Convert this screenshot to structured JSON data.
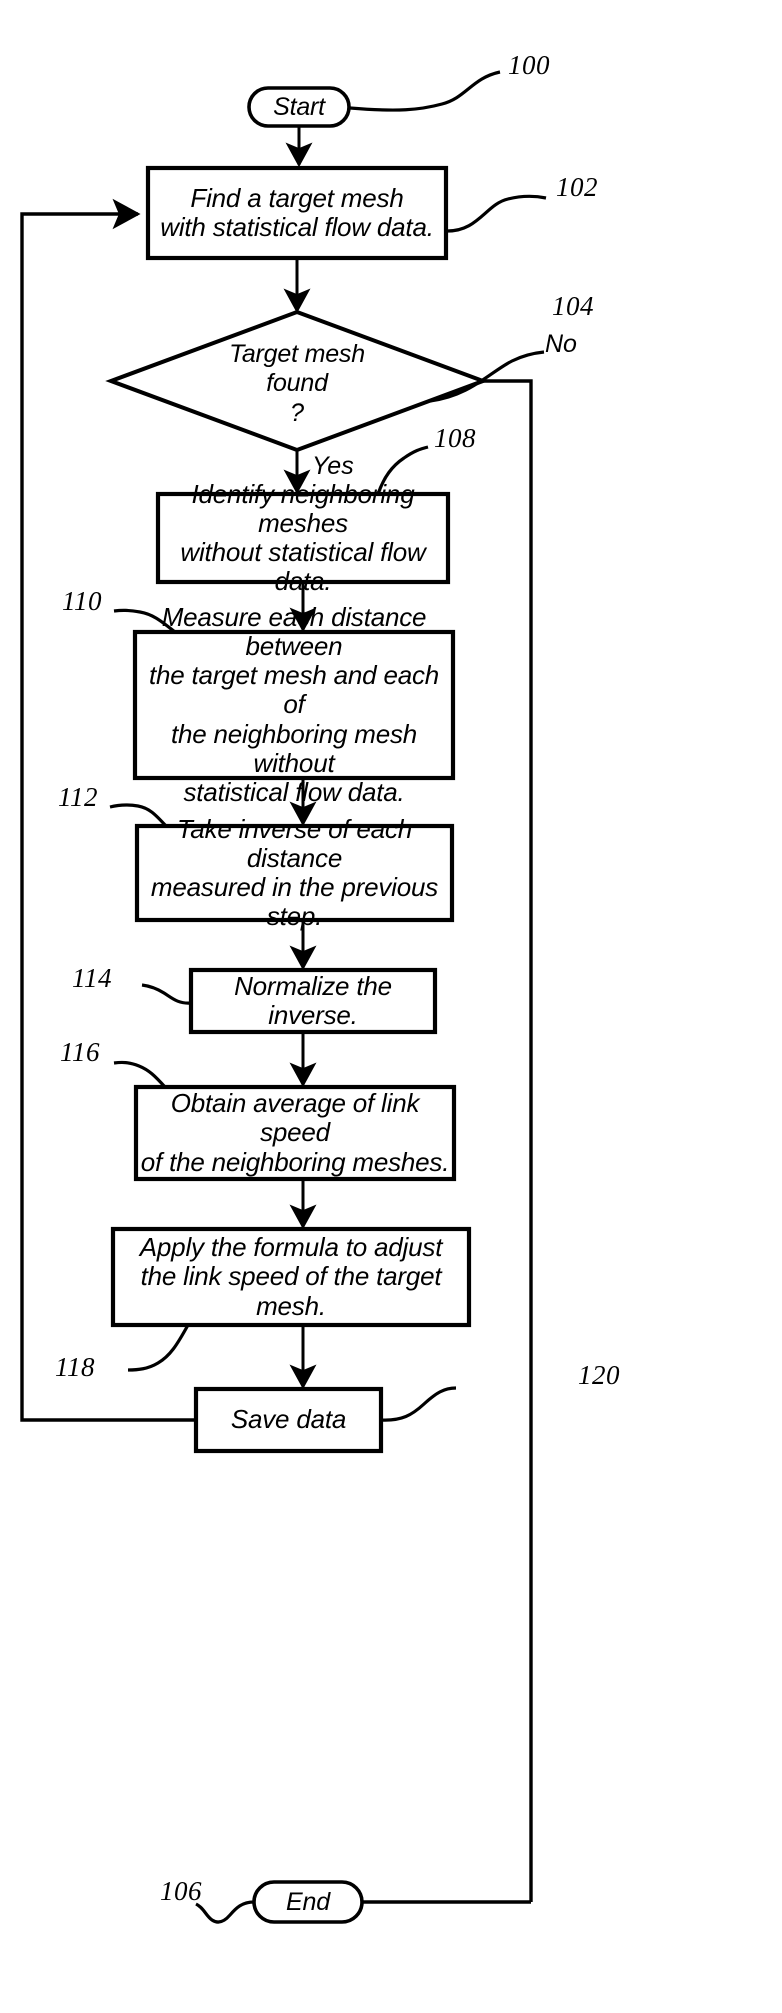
{
  "figure": {
    "type": "patent-flowchart",
    "title": "",
    "stroke_color": "#000000",
    "background_color": "#ffffff"
  },
  "nodes": {
    "start": {
      "ref": "100",
      "label": "Start",
      "shape": "terminator"
    },
    "find_target": {
      "ref": "102",
      "label": "Find a target mesh\nwith statistical flow data.",
      "shape": "process"
    },
    "decision": {
      "ref": "104",
      "label": "Target mesh\nfound\n?",
      "shape": "decision"
    },
    "identify": {
      "ref": "108",
      "label": "Identify neighboring meshes\nwithout statistical flow data.",
      "shape": "process"
    },
    "measure": {
      "ref": "110",
      "label": "Measure each distance between\nthe target mesh and each of\nthe neighboring mesh without\nstatistical flow data.",
      "shape": "process"
    },
    "inverse": {
      "ref": "112",
      "label": "Take inverse of each distance\nmeasured in the previous step.",
      "shape": "process"
    },
    "normalize": {
      "ref": "114",
      "label": "Normalize the inverse.",
      "shape": "process"
    },
    "average": {
      "ref": "116",
      "label": "Obtain average of link speed\nof the neighboring meshes.",
      "shape": "process"
    },
    "apply": {
      "ref": "118",
      "label": "Apply the formula to adjust\nthe link speed of the target mesh.",
      "shape": "process"
    },
    "save": {
      "ref": "120",
      "label": "Save data",
      "shape": "process"
    },
    "end": {
      "ref": "106",
      "label": "End",
      "shape": "terminator"
    }
  },
  "branch_labels": {
    "no": "No",
    "yes": "Yes"
  }
}
